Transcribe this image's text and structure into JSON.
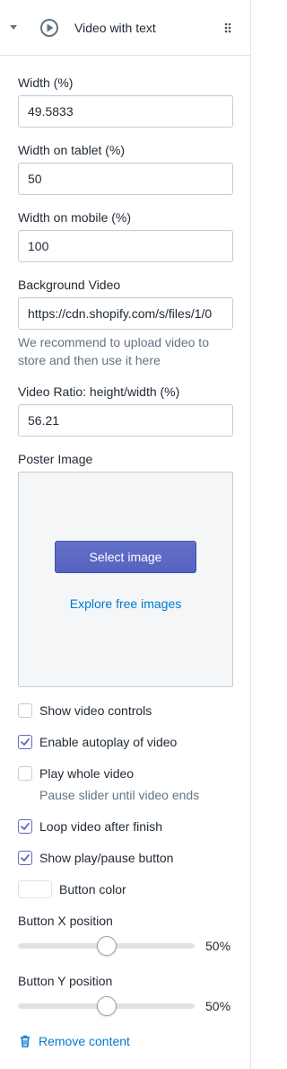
{
  "header": {
    "title": "Video with text"
  },
  "fields": {
    "width": {
      "label": "Width (%)",
      "value": "49.5833"
    },
    "width_tablet": {
      "label": "Width on tablet (%)",
      "value": "50"
    },
    "width_mobile": {
      "label": "Width on mobile (%)",
      "value": "100"
    },
    "background_video": {
      "label": "Background Video",
      "value": "https://cdn.shopify.com/s/files/1/0",
      "help": "We recommend to upload video to store and then use it here"
    },
    "video_ratio": {
      "label": "Video Ratio: height/width (%)",
      "value": "56.21"
    },
    "poster_image": {
      "label": "Poster Image",
      "select_label": "Select image",
      "explore_label": "Explore free images"
    }
  },
  "checkboxes": {
    "show_controls": {
      "label": "Show video controls",
      "checked": false
    },
    "autoplay": {
      "label": "Enable autoplay of video",
      "checked": true
    },
    "play_whole": {
      "label": "Play whole video",
      "checked": false,
      "help": "Pause slider until video ends"
    },
    "loop": {
      "label": "Loop video after finish",
      "checked": true
    },
    "play_pause": {
      "label": "Show play/pause button",
      "checked": true
    }
  },
  "button_color": {
    "label": "Button color",
    "value": "#ffffff"
  },
  "sliders": {
    "x": {
      "label": "Button X position",
      "value": 50,
      "display": "50%"
    },
    "y": {
      "label": "Button Y position",
      "value": 50,
      "display": "50%"
    }
  },
  "remove": {
    "label": "Remove content"
  },
  "colors": {
    "accent": "#5c6ac4",
    "link": "#007ace",
    "border": "#c4cdd5"
  },
  "icons": {
    "collapse": "caret-down-icon",
    "section": "play-circle-icon",
    "drag": "drag-handle-icon",
    "remove": "trash-icon"
  }
}
